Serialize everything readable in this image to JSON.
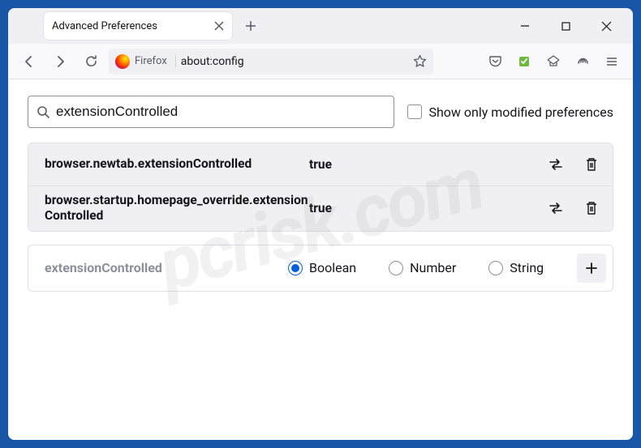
{
  "window": {
    "tab_title": "Advanced Preferences"
  },
  "toolbar": {
    "identity_label": "Firefox",
    "url": "about:config"
  },
  "config": {
    "search_value": "extensionControlled",
    "show_modified_label": "Show only modified preferences",
    "results": [
      {
        "name": "browser.newtab.extensionControlled",
        "value": "true"
      },
      {
        "name": "browser.startup.homepage_override.extensionControlled",
        "value": "true"
      }
    ],
    "add": {
      "new_pref_name": "extensionControlled",
      "types": {
        "boolean": "Boolean",
        "number": "Number",
        "string": "String"
      }
    }
  },
  "watermark": "pcrisk.com"
}
